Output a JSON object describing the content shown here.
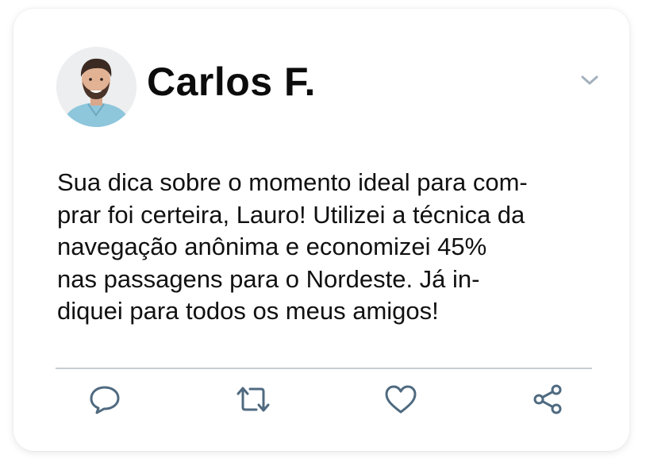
{
  "post": {
    "author": "Carlos F.",
    "body_lines": [
      "Sua dica sobre o momento ideal para com-",
      "prar foi certeira, Lauro! Utilizei a técnica da",
      "navegação anônima e economizei 45%",
      "nas passagens para o Nordeste. Já in-",
      "diquei para todos os meus amigos!"
    ]
  },
  "icons": {
    "menu": "chevron-down-icon",
    "reply": "comment-icon",
    "retweet": "retweet-icon",
    "like": "heart-icon",
    "share": "share-icon"
  },
  "colors": {
    "icon": "#4f6a80",
    "chevron": "#a3b1bd",
    "text": "#111111",
    "divider": "#c8ccd0"
  }
}
